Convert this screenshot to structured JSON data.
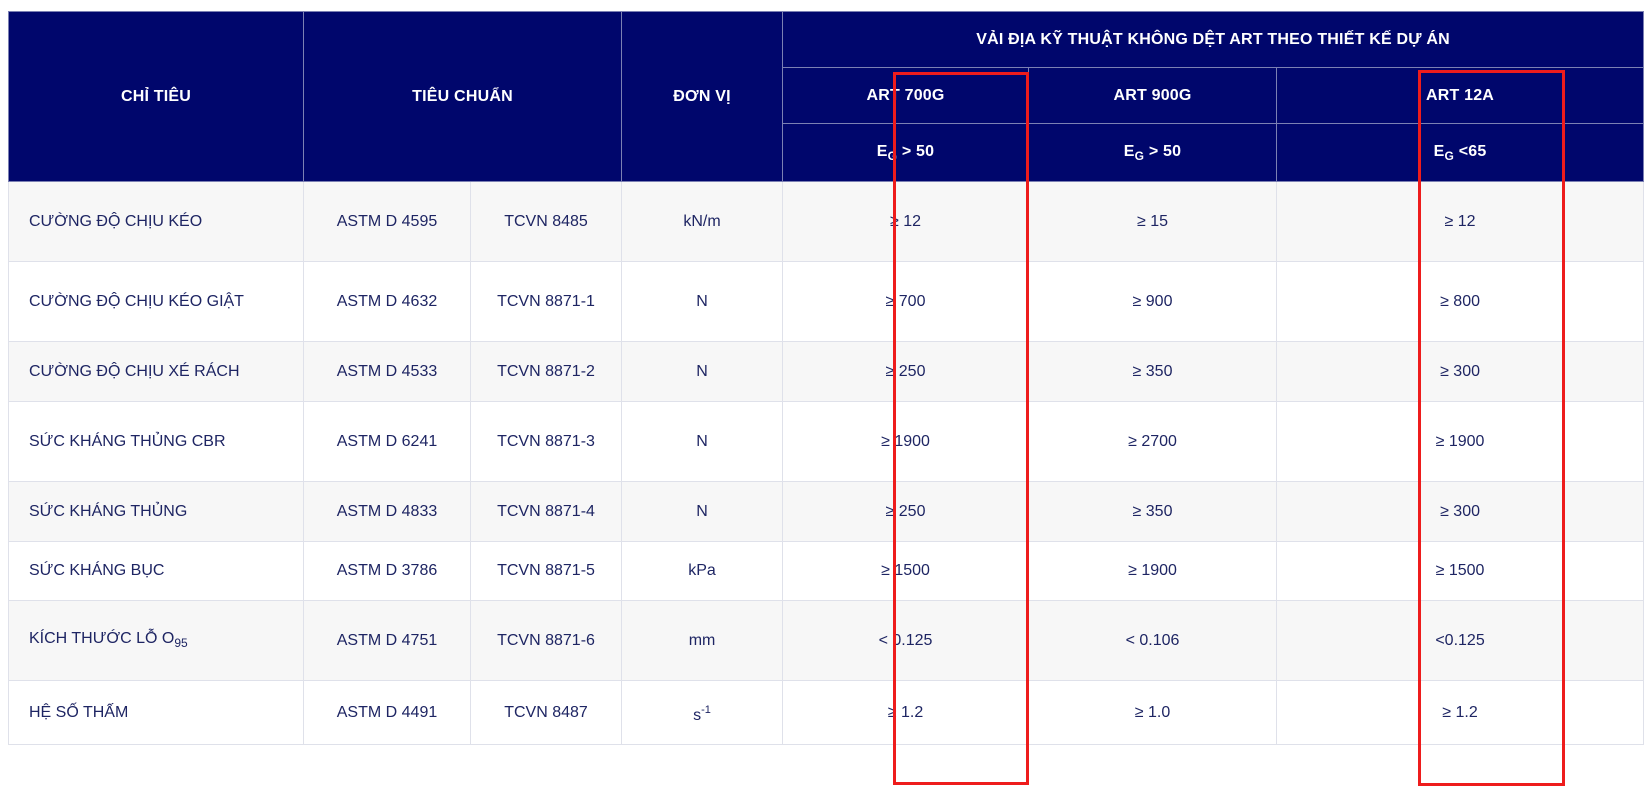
{
  "table": {
    "headers": {
      "criteria": "CHỈ TIÊU",
      "standard": "TIÊU CHUẨN",
      "unit": "ĐƠN VỊ",
      "group": "VẢI ĐỊA KỸ THUẬT KHÔNG DỆT ART THEO THIẾT KẾ DỰ ÁN",
      "products": [
        {
          "name": "ART 700G",
          "eg_letter": "E",
          "eg_sub": "G",
          "eg_cond": " > 50"
        },
        {
          "name": "ART 900G",
          "eg_letter": "E",
          "eg_sub": "G",
          "eg_cond": " > 50"
        },
        {
          "name": "ART 12A",
          "eg_letter": "E",
          "eg_sub": "G",
          "eg_cond": " <65"
        }
      ]
    },
    "rows": [
      {
        "criteria": "CƯỜNG ĐỘ CHỊU KÉO",
        "astm": "ASTM D 4595",
        "tcvn": "TCVN 8485",
        "unit": "kN/m",
        "art700g": "≥ 12",
        "art900g": "≥ 15",
        "art12a": "≥ 12"
      },
      {
        "criteria": "CƯỜNG ĐỘ CHỊU KÉO GIẬT",
        "astm": "ASTM D 4632",
        "tcvn": "TCVN 8871-1",
        "unit": "N",
        "art700g": "≥ 700",
        "art900g": "≥ 900",
        "art12a": "≥ 800"
      },
      {
        "criteria": "CƯỜNG ĐỘ CHỊU XÉ RÁCH",
        "astm": "ASTM D 4533",
        "tcvn": "TCVN 8871-2",
        "unit": "N",
        "art700g": "≥ 250",
        "art900g": "≥ 350",
        "art12a": "≥ 300"
      },
      {
        "criteria": "SỨC KHÁNG THỦNG CBR",
        "astm": "ASTM D 6241",
        "tcvn": "TCVN 8871-3",
        "unit": "N",
        "art700g": "≥ 1900",
        "art900g": "≥ 2700",
        "art12a": "≥ 1900"
      },
      {
        "criteria": "SỨC KHÁNG THỦNG",
        "astm": "ASTM D 4833",
        "tcvn": "TCVN 8871-4",
        "unit": "N",
        "art700g": "≥ 250",
        "art900g": "≥ 350",
        "art12a": "≥ 300"
      },
      {
        "criteria": "SỨC KHÁNG BỤC",
        "astm": "ASTM D 3786",
        "tcvn": "TCVN 8871-5",
        "unit": "kPa",
        "art700g": "≥ 1500",
        "art900g": "≥ 1900",
        "art12a": "≥ 1500"
      },
      {
        "criteria": "KÍCH THƯỚC LỖ O",
        "criteria_sub": "95",
        "astm": "ASTM D 4751",
        "tcvn": "TCVN 8871-6",
        "unit": "mm",
        "art700g": "< 0.125",
        "art900g": "< 0.106",
        "art12a": "<0.125"
      },
      {
        "criteria": "HỆ SỐ THẤM",
        "astm": "ASTM D 4491",
        "tcvn": "TCVN 8487",
        "unit": "s",
        "unit_sup": "-1",
        "art700g": "≥ 1.2",
        "art900g": "≥ 1.0",
        "art12a": "≥ 1.2"
      }
    ]
  },
  "highlight_color": "#ee1c1c",
  "header_color": "#00066c"
}
